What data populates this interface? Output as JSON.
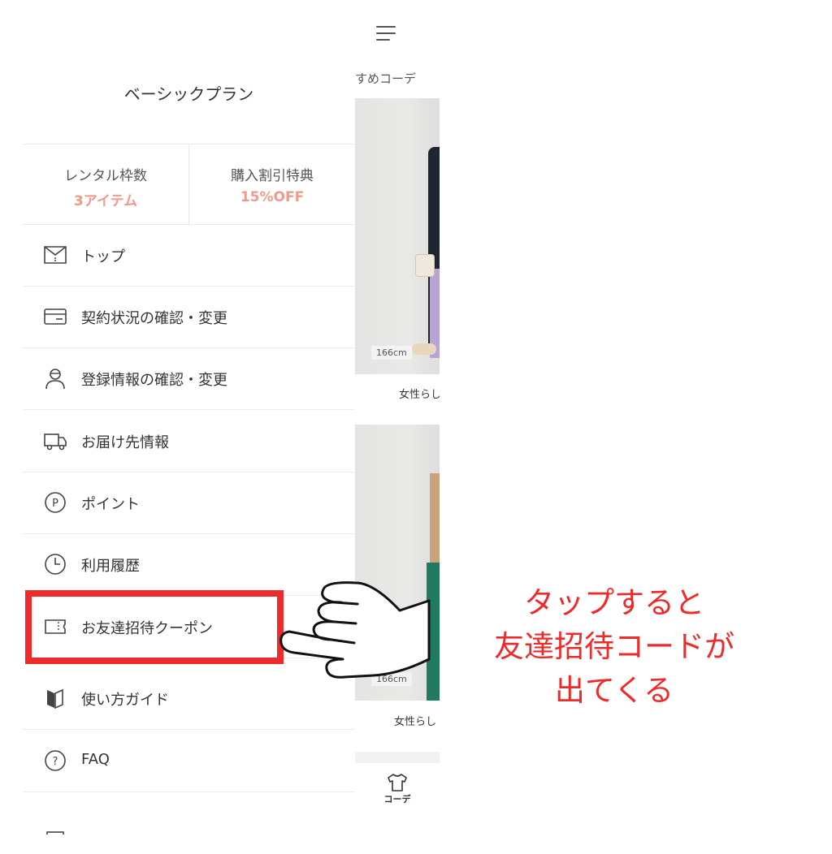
{
  "drawer": {
    "plan_title": "ベーシックプラン",
    "stats": [
      {
        "label": "レンタル枠数",
        "value": "3アイテム"
      },
      {
        "label": "購入割引特典",
        "value": "15%OFF"
      }
    ],
    "menu": [
      {
        "label": "トップ",
        "icon": "top-page-icon"
      },
      {
        "label": "契約状況の確認・変更",
        "icon": "card-icon"
      },
      {
        "label": "登録情報の確認・変更",
        "icon": "user-icon"
      },
      {
        "label": "お届け先情報",
        "icon": "truck-icon"
      },
      {
        "label": "ポイント",
        "icon": "point-icon"
      },
      {
        "label": "利用履歴",
        "icon": "clock-icon"
      },
      {
        "label": "お友達招待クーポン",
        "icon": "coupon-icon"
      },
      {
        "label": "使い方ガイド",
        "icon": "book-icon"
      },
      {
        "label": "FAQ",
        "icon": "question-icon"
      }
    ]
  },
  "background_app": {
    "section_label": "すめコーデ",
    "items": [
      {
        "height_tag": "166cm",
        "caption": "女性らし"
      },
      {
        "height_tag": "166cm",
        "caption": "女性らし"
      }
    ],
    "tab_label": "コーデ"
  },
  "annotation": {
    "lines": [
      "タップすると",
      "友達招待コードが",
      "出てくる"
    ],
    "color": "#ee2b2b"
  },
  "colors": {
    "accent": "#ef9a8c",
    "highlight": "#ee2b2b"
  }
}
